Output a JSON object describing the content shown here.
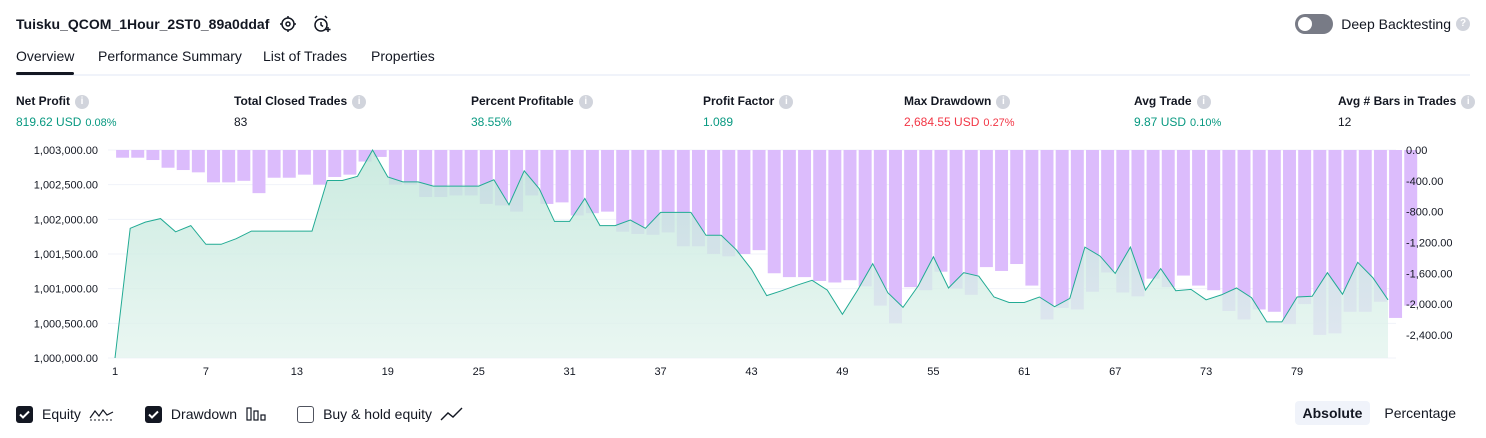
{
  "header": {
    "title": "Tuisku_QCOM_1Hour_2ST0_89a0ddaf",
    "deep_backtesting_label": "Deep Backtesting",
    "deep_backtesting_enabled": false
  },
  "tabs": [
    "Overview",
    "Performance Summary",
    "List of Trades",
    "Properties"
  ],
  "active_tab": "Overview",
  "metrics": {
    "net_profit": {
      "label": "Net Profit",
      "value": "819.62 USD",
      "pct": "0.08%"
    },
    "total_closed_trades": {
      "label": "Total Closed Trades",
      "value": "83"
    },
    "percent_profitable": {
      "label": "Percent Profitable",
      "value": "38.55%"
    },
    "profit_factor": {
      "label": "Profit Factor",
      "value": "1.089"
    },
    "max_drawdown": {
      "label": "Max Drawdown",
      "value": "2,684.55 USD",
      "pct": "0.27%"
    },
    "avg_trade": {
      "label": "Avg Trade",
      "value": "9.87 USD",
      "pct": "0.10%"
    },
    "avg_bars": {
      "label": "Avg # Bars in Trades",
      "value": "12"
    }
  },
  "legend": {
    "equity": {
      "label": "Equity",
      "checked": true
    },
    "drawdown": {
      "label": "Drawdown",
      "checked": true
    },
    "buy_hold": {
      "label": "Buy & hold equity",
      "checked": false
    }
  },
  "mode": {
    "absolute": "Absolute",
    "percentage": "Percentage",
    "selected": "Absolute"
  },
  "colors": {
    "profit": "#089981",
    "loss": "#f23645",
    "drawdown_bar": "#dcbcfc",
    "equity_line": "#22ab94"
  },
  "chart_data": {
    "type": "area",
    "x_tick_labels": [
      "1",
      "7",
      "13",
      "19",
      "25",
      "31",
      "37",
      "43",
      "49",
      "55",
      "61",
      "67",
      "73",
      "79"
    ],
    "x_ticks": [
      1,
      7,
      13,
      19,
      25,
      31,
      37,
      43,
      49,
      55,
      61,
      67,
      73,
      79
    ],
    "left_axis": {
      "ticks": [
        "1,000,000.00",
        "1,000,500.00",
        "1,001,000.00",
        "1,001,500.00",
        "1,002,000.00",
        "1,002,500.00",
        "1,003,000.00"
      ],
      "ylim": [
        1000000,
        1003000
      ]
    },
    "right_axis": {
      "ticks": [
        "0.00",
        "-400.00",
        "-800.00",
        "-1,200.00",
        "-1,600.00",
        "-2,000.00",
        "-2,400.00"
      ],
      "ylim": [
        -2700,
        0
      ]
    },
    "equity": [
      1000000,
      1001870,
      1001960,
      1002010,
      1001820,
      1001910,
      1001640,
      1001640,
      1001720,
      1001830,
      1001830,
      1001830,
      1001830,
      1001830,
      1002560,
      1002560,
      1002620,
      1003000,
      1002610,
      1002540,
      1002540,
      1002480,
      1002480,
      1002480,
      1002480,
      1002570,
      1002210,
      1002700,
      1002440,
      1001970,
      1001970,
      1002300,
      1001910,
      1001910,
      1001990,
      1001870,
      1002100,
      1002100,
      1002100,
      1001770,
      1001770,
      1001560,
      1001280,
      1000900,
      1000970,
      1001050,
      1001120,
      1000980,
      1000630,
      1000980,
      1001360,
      1000940,
      1000730,
      1001040,
      1001460,
      1001010,
      1001230,
      1001180,
      1000880,
      1000800,
      1000800,
      1000880,
      1000740,
      1000860,
      1001600,
      1001470,
      1001220,
      1001600,
      1000980,
      1001290,
      1000970,
      1000990,
      1000840,
      1000910,
      1001010,
      1000870,
      1000520,
      1000520,
      1000880,
      1000890,
      1001230,
      1000920,
      1001380,
      1001160,
      1000840
    ],
    "drawdown": [
      -100,
      -100,
      -130,
      -230,
      -260,
      -290,
      -420,
      -420,
      -400,
      -560,
      -360,
      -360,
      -320,
      -450,
      -350,
      -320,
      -150,
      -90,
      -450,
      -450,
      -610,
      -610,
      -590,
      -590,
      -700,
      -720,
      -800,
      -590,
      -700,
      -680,
      -850,
      -820,
      -800,
      -1060,
      -1090,
      -1100,
      -1070,
      -1250,
      -1250,
      -1350,
      -1380,
      -1350,
      -1300,
      -1600,
      -1650,
      -1650,
      -1700,
      -1720,
      -1690,
      -1770,
      -2020,
      -2250,
      -1780,
      -1820,
      -1580,
      -1800,
      -1880,
      -1520,
      -1570,
      -1480,
      -1760,
      -2200,
      -2050,
      -2070,
      -1840,
      -1590,
      -1850,
      -1900,
      -1670,
      -1780,
      -1630,
      -1760,
      -1820,
      -2090,
      -2200,
      -2070,
      -2100,
      -2260,
      -2000,
      -2400,
      -2380,
      -2100,
      -2100,
      -1970,
      -2180,
      -2020
    ]
  }
}
